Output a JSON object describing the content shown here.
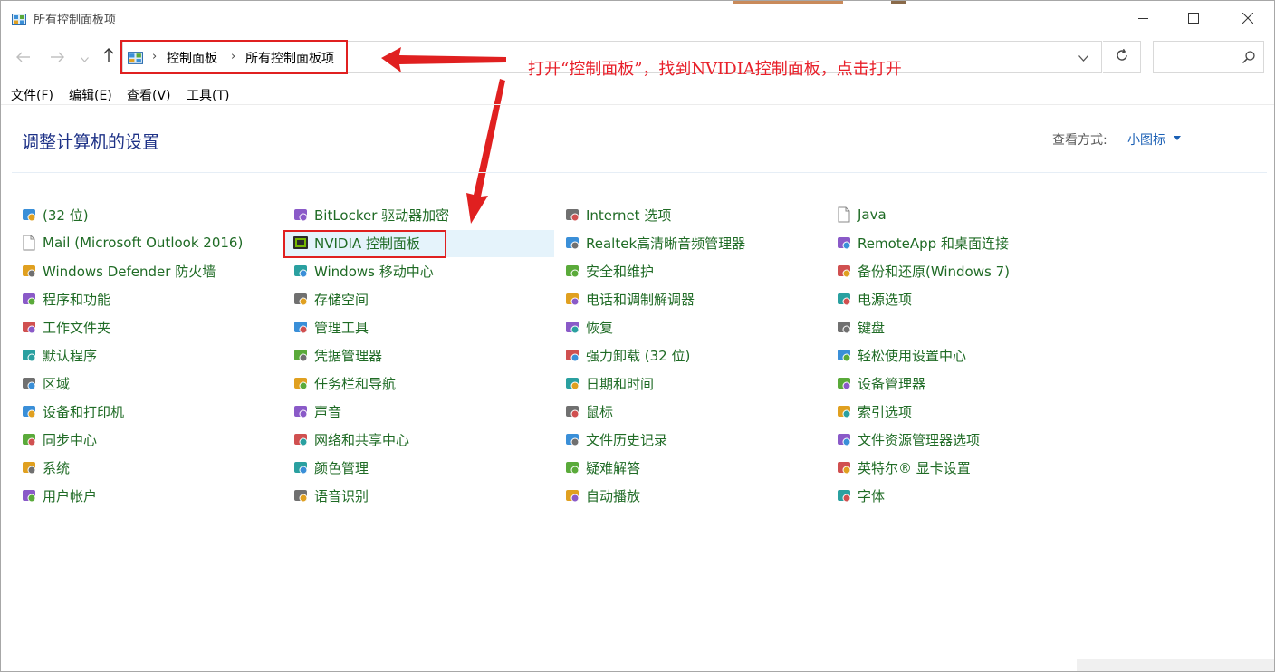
{
  "window": {
    "title": "所有控制面板项",
    "min_icon": "minimize-icon",
    "max_icon": "maximize-icon",
    "close_icon": "close-icon"
  },
  "nav": {
    "back_icon": "back-arrow-icon",
    "forward_icon": "forward-arrow-icon",
    "recent_icon": "chevron-down-icon",
    "up_icon": "up-arrow-icon"
  },
  "address": {
    "crumbs": [
      "控制面板",
      "所有控制面板项"
    ],
    "refresh_icon": "refresh-icon",
    "search_placeholder": "",
    "search_icon": "search-icon"
  },
  "annotation": {
    "text": "打开“控制面板”，找到NVIDIA控制面板，点击打开",
    "color": "#e8202a"
  },
  "menu": [
    "文件(F)",
    "编辑(E)",
    "查看(V)",
    "工具(T)"
  ],
  "main": {
    "heading": "调整计算机的设置",
    "view_by_label": "查看方式:",
    "view_by_value": "小图标"
  },
  "columns": [
    [
      "(32 位)",
      "Mail (Microsoft Outlook 2016)",
      "Windows Defender 防火墙",
      "程序和功能",
      "工作文件夹",
      "默认程序",
      "区域",
      "设备和打印机",
      "同步中心",
      "系统",
      "用户帐户"
    ],
    [
      "BitLocker 驱动器加密",
      "NVIDIA 控制面板",
      "Windows 移动中心",
      "存储空间",
      "管理工具",
      "凭据管理器",
      "任务栏和导航",
      "声音",
      "网络和共享中心",
      "颜色管理",
      "语音识别"
    ],
    [
      "Internet 选项",
      "Realtek高清晰音频管理器",
      "安全和维护",
      "电话和调制解调器",
      "恢复",
      "强力卸载 (32 位)",
      "日期和时间",
      "鼠标",
      "文件历史记录",
      "疑难解答",
      "自动播放"
    ],
    [
      "Java",
      "RemoteApp 和桌面连接",
      "备份和还原(Windows 7)",
      "电源选项",
      "键盘",
      "轻松使用设置中心",
      "设备管理器",
      "索引选项",
      "文件资源管理器选项",
      "英特尔® 显卡设置",
      "字体"
    ]
  ],
  "colors": {
    "link_green": "#1f6b25",
    "heading_blue": "#1e3287",
    "highlight": "#e5f3fb",
    "annotation_red": "#e02020"
  }
}
